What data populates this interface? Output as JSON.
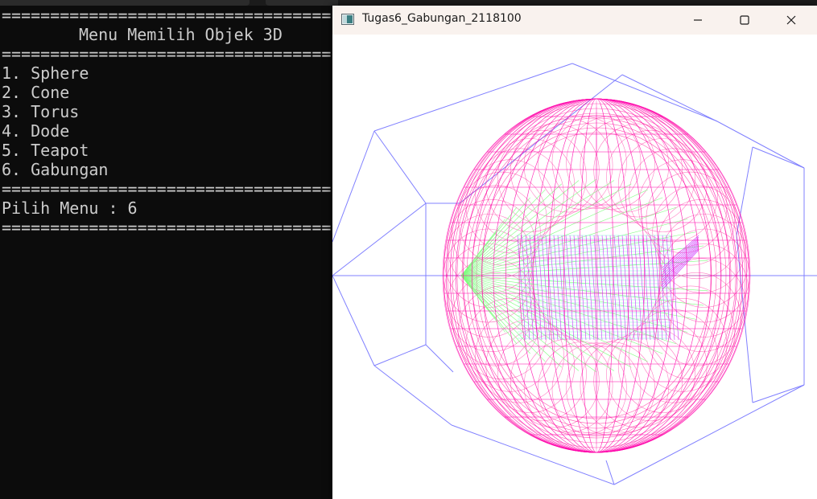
{
  "console": {
    "lines": [
      {
        "text": "==================================",
        "kind": "sep"
      },
      {
        "text": "Menu Memilih Objek 3D",
        "kind": "title"
      },
      {
        "text": "==================================",
        "kind": "sep"
      },
      {
        "text": "1. Sphere",
        "kind": "item"
      },
      {
        "text": "2. Cone",
        "kind": "item"
      },
      {
        "text": "3. Torus",
        "kind": "item"
      },
      {
        "text": "4. Dode",
        "kind": "item"
      },
      {
        "text": "5. Teapot",
        "kind": "item"
      },
      {
        "text": "6. Gabungan",
        "kind": "item"
      },
      {
        "text": "==================================",
        "kind": "sep"
      },
      {
        "text": "Pilih Menu : 6",
        "kind": "prompt"
      },
      {
        "text": "==================================",
        "kind": "sep"
      }
    ]
  },
  "window": {
    "title": "Tugas6_Gabungan_2118100",
    "icons": {
      "app": "app-window-icon",
      "minimize": "minimize-icon",
      "maximize": "maximize-icon",
      "close": "close-icon"
    }
  },
  "colors": {
    "console_bg": "#0c0c0c",
    "console_text": "#cccccc",
    "titlebar_bg": "#f9f2ee",
    "dodecahedron": "#8080ff",
    "sphere": "#ff00aa",
    "torus": "#ff1493",
    "cone": "#7fff7f",
    "teapot": "#cc33ff",
    "teapot_fill": "#7fffd4"
  }
}
